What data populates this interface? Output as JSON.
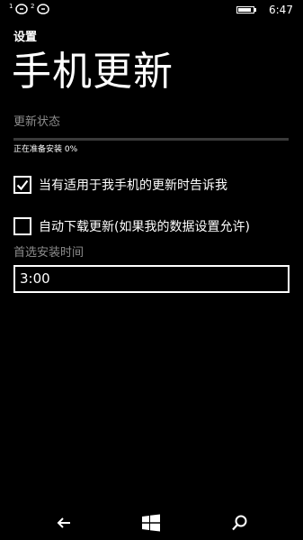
{
  "status_bar": {
    "sim1_number": "1",
    "sim2_number": "2",
    "battery_level": 0.85,
    "time": "6:47"
  },
  "header": {
    "app_title": "设置",
    "page_title": "手机更新"
  },
  "update_status": {
    "label": "更新状态",
    "progress_text": "正在准备安装 0%",
    "progress_percent": 0
  },
  "options": {
    "notify_label": "当有适用于我手机的更新时告诉我",
    "notify_checked": true,
    "auto_download_label": "自动下载更新(如果我的数据设置允许)",
    "auto_download_checked": false
  },
  "install_time": {
    "label": "首选安装时间",
    "value": "3:00"
  },
  "nav": {
    "back_icon": "back-arrow-icon",
    "home_icon": "windows-logo-icon",
    "search_icon": "search-icon"
  },
  "colors": {
    "background": "#000000",
    "foreground": "#ffffff",
    "muted": "#8c8c8c"
  }
}
